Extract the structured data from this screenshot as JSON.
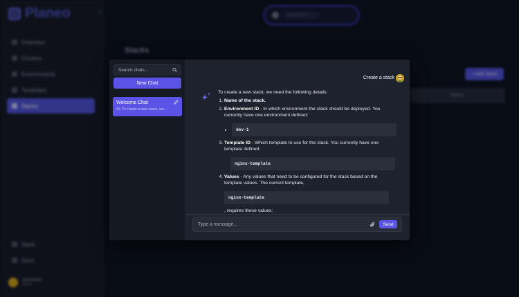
{
  "app": {
    "brand": "Planeo",
    "nav": [
      {
        "label": "Overview",
        "icon": "home-icon"
      },
      {
        "label": "Clusters",
        "icon": "cluster-icon"
      },
      {
        "label": "Environments",
        "icon": "grid-icon"
      },
      {
        "label": "Templates",
        "icon": "template-icon"
      },
      {
        "label": "Stacks",
        "icon": "stack-icon",
        "active": true
      }
    ],
    "nav_bottom": [
      {
        "label": "Slack",
        "icon": "slack-icon"
      },
      {
        "label": "Docs",
        "icon": "docs-icon"
      }
    ],
    "user": {
      "name": "devfrontier",
      "sub": "Admin"
    },
    "search_placeholder": "Ask Planeo",
    "page_title": "Stacks",
    "add_button": "+ Add Stack",
    "table_header": "Actions"
  },
  "chat": {
    "search_placeholder": "Search chats...",
    "new_chat_label": "New Chat",
    "conversations": [
      {
        "title": "Welcome Chat",
        "preview": "AI: To create a new stack, we..."
      }
    ],
    "user_message": "Create a stack",
    "ai": {
      "intro": "To create a new stack, we need the following details:",
      "items": [
        {
          "title": "Name of the stack.",
          "text": ""
        },
        {
          "title": "Environment ID",
          "text": " - In which environment the stack should be deployed. You currently have one environment defined:",
          "code": "dev-1"
        },
        {
          "title": "Template ID",
          "text": " - Which template to use for the stack. You currently have one template defined:",
          "code": "nginx-template"
        },
        {
          "title": "Values",
          "text": " - Any values that need to be configured for the stack based on the template values. The current template,",
          "code": "nginx-template",
          "after": ", requires these values:"
        }
      ]
    },
    "composer_placeholder": "Type a message...",
    "send_label": "Send",
    "colors": {
      "accent": "#5b53e6",
      "panel": "#1d222c",
      "sidebar": "#151a22"
    }
  }
}
